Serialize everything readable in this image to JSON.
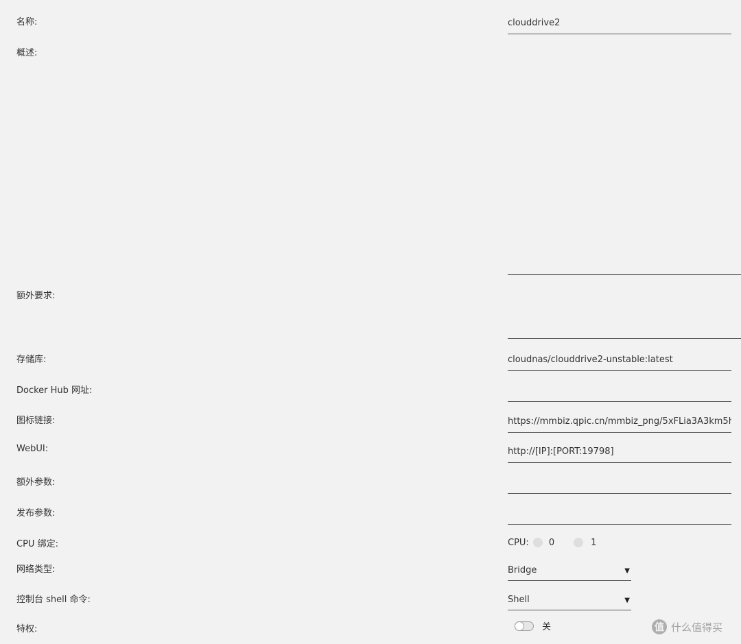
{
  "form": {
    "name": {
      "label": "名称:",
      "value": "clouddrive2"
    },
    "description": {
      "label": "概述:",
      "value": ""
    },
    "extra_requirements": {
      "label": "额外要求:",
      "value": ""
    },
    "repository": {
      "label": "存储库:",
      "value": "cloudnas/clouddrive2-unstable:latest"
    },
    "docker_hub_url": {
      "label": "Docker Hub 网址:",
      "value": ""
    },
    "icon_link": {
      "label": "图标链接:",
      "value": "https://mmbiz.qpic.cn/mmbiz_png/5xFLia3A3km5h"
    },
    "webui": {
      "label": "WebUI:",
      "value": "http://[IP]:[PORT:19798]"
    },
    "extra_params": {
      "label": "额外参数:",
      "value": ""
    },
    "publish_params": {
      "label": "发布参数:",
      "value": ""
    },
    "cpu_pinning": {
      "label": "CPU 绑定:",
      "prefix": "CPU:",
      "options": [
        "0",
        "1"
      ]
    },
    "network_type": {
      "label": "网络类型:",
      "selected": "Bridge"
    },
    "console_shell": {
      "label": "控制台 shell 命令:",
      "selected": "Shell"
    },
    "privileged": {
      "label": "特权:",
      "state_label": "关",
      "enabled": false
    }
  },
  "watermark": {
    "text": "什么值得买",
    "logo_char": "值"
  },
  "colors": {
    "background": "#f2f2f2",
    "underline": "#555555",
    "text": "#333333"
  }
}
